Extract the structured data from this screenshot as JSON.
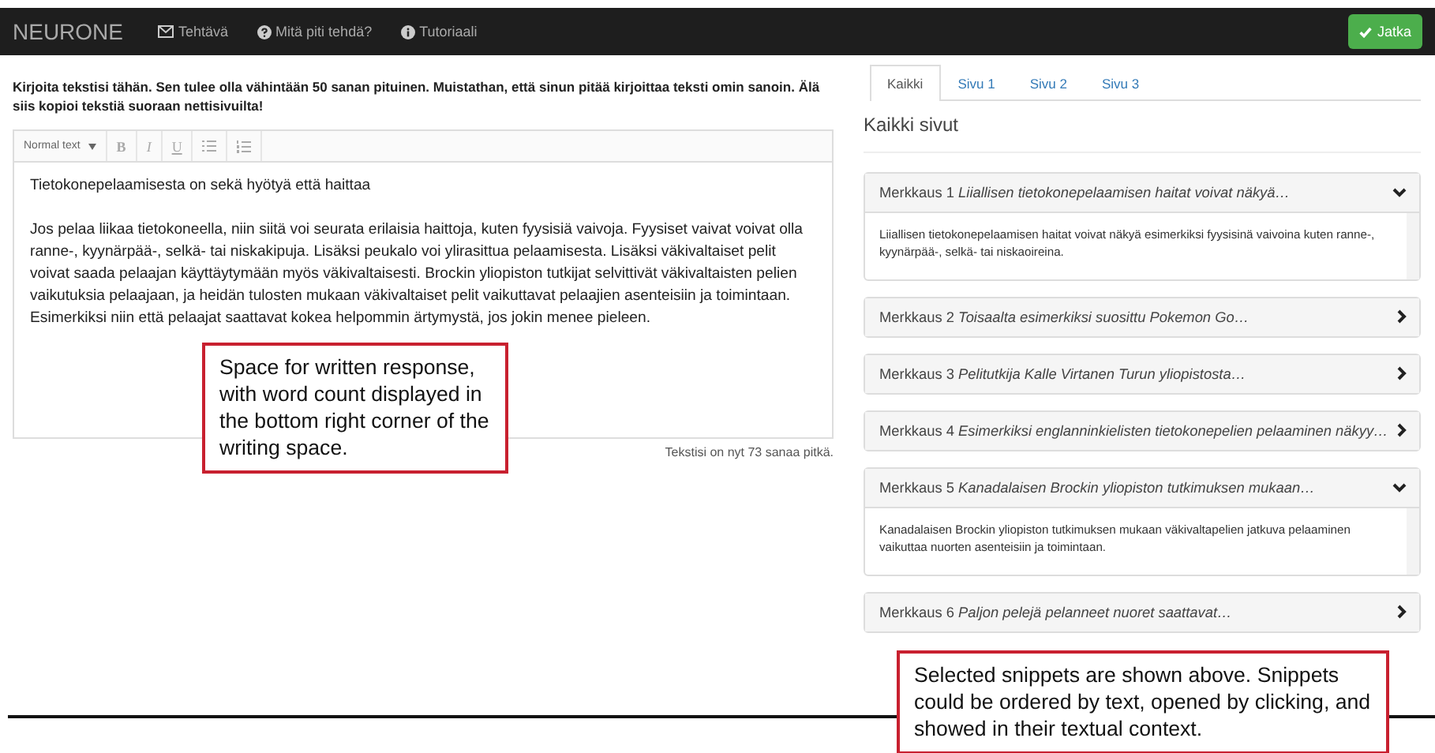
{
  "navbar": {
    "brand": "NEURONE",
    "items": [
      {
        "kind": "envelope",
        "label": "Tehtävä"
      },
      {
        "kind": "question",
        "label": "Mitä piti tehdä?"
      },
      {
        "kind": "info",
        "label": "Tutoriaali"
      }
    ],
    "continue_button": {
      "label": "Jatka"
    }
  },
  "instructions": "Kirjoita tekstisi tähän. Sen tulee olla vähintään 50 sanan pituinen. Muistathan, että sinun pitää kirjoittaa teksti omin sanoin. Älä siis kopioi tekstiä suoraan nettisivuilta!",
  "toolbar": {
    "style_label": "Normal text",
    "buttons": [
      {
        "kind": "bold",
        "label": "B"
      },
      {
        "kind": "italic",
        "label": "I"
      },
      {
        "kind": "underline",
        "label": "U"
      },
      {
        "kind": "bullet-list"
      },
      {
        "kind": "numbered-list"
      }
    ]
  },
  "editor": {
    "title": "Tietokonepelaamisesta on sekä hyötyä että haittaa",
    "paragraph": "Jos pelaa liikaa tietokoneella, niin siitä voi seurata erilaisia haittoja, kuten fyysisiä vaivoja. Fyysiset vaivat voivat olla ranne-, kyynärpää-, selkä- tai niskakipuja. Lisäksi peukalo voi ylirasittua pelaamisesta. Lisäksi väkivaltaiset pelit voivat saada pelaajan käyttäytymään myös väkivaltaisesti. Brockin yliopiston tutkijat selvittivät väkivaltaisten pelien vaikutuksia pelaajaan, ja heidän tulosten mukaan väkivaltaiset pelit vaikuttavat pelaajien asenteisiin ja toimintaan. Esimerkiksi niin että pelaajat saattavat kokea helpommin ärtymystä, jos jokin menee pieleen."
  },
  "word_count": "Tekstisi on nyt 73 sanaa pitkä.",
  "tabs": [
    {
      "label": "Kaikki",
      "selected": true
    },
    {
      "label": "Sivu 1",
      "selected": false
    },
    {
      "label": "Sivu 2",
      "selected": false
    },
    {
      "label": "Sivu 3",
      "selected": false
    }
  ],
  "section_title": "Kaikki sivut",
  "snippets": [
    {
      "label": "Merkkaus 1",
      "excerpt": "Liiallisen tietokonepelaamisen haitat voivat näkyä…",
      "expanded": true,
      "body": "Liiallisen tietokonepelaamisen haitat voivat näkyä esimerkiksi fyysisinä vaivoina kuten ranne-, kyynärpää-, selkä- tai niskaoireina."
    },
    {
      "label": "Merkkaus 2",
      "excerpt": "Toisaalta esimerkiksi suosittu Pokemon Go…",
      "expanded": false
    },
    {
      "label": "Merkkaus 3",
      "excerpt": "Pelitutkija Kalle Virtanen Turun yliopistosta…",
      "expanded": false
    },
    {
      "label": "Merkkaus 4",
      "excerpt": "Esimerkiksi englanninkielisten tietokonepelien pelaaminen näkyy…",
      "expanded": false
    },
    {
      "label": "Merkkaus 5",
      "excerpt": "Kanadalaisen Brockin yliopiston tutkimuksen mukaan…",
      "expanded": true,
      "body": "Kanadalaisen Brockin yliopiston tutkimuksen mukaan väkivaltapelien jatkuva pelaaminen vaikuttaa nuorten asenteisiin ja toimintaan."
    },
    {
      "label": "Merkkaus 6",
      "excerpt": "Paljon pelejä pelanneet nuoret saattavat…",
      "expanded": false
    }
  ],
  "annotations": [
    "Space for written response, with word count displayed in the bottom right corner of the writing space.",
    "Selected snippets are shown above. Snippets could be ordered by text, opened by clicking, and showed in their textual context."
  ]
}
